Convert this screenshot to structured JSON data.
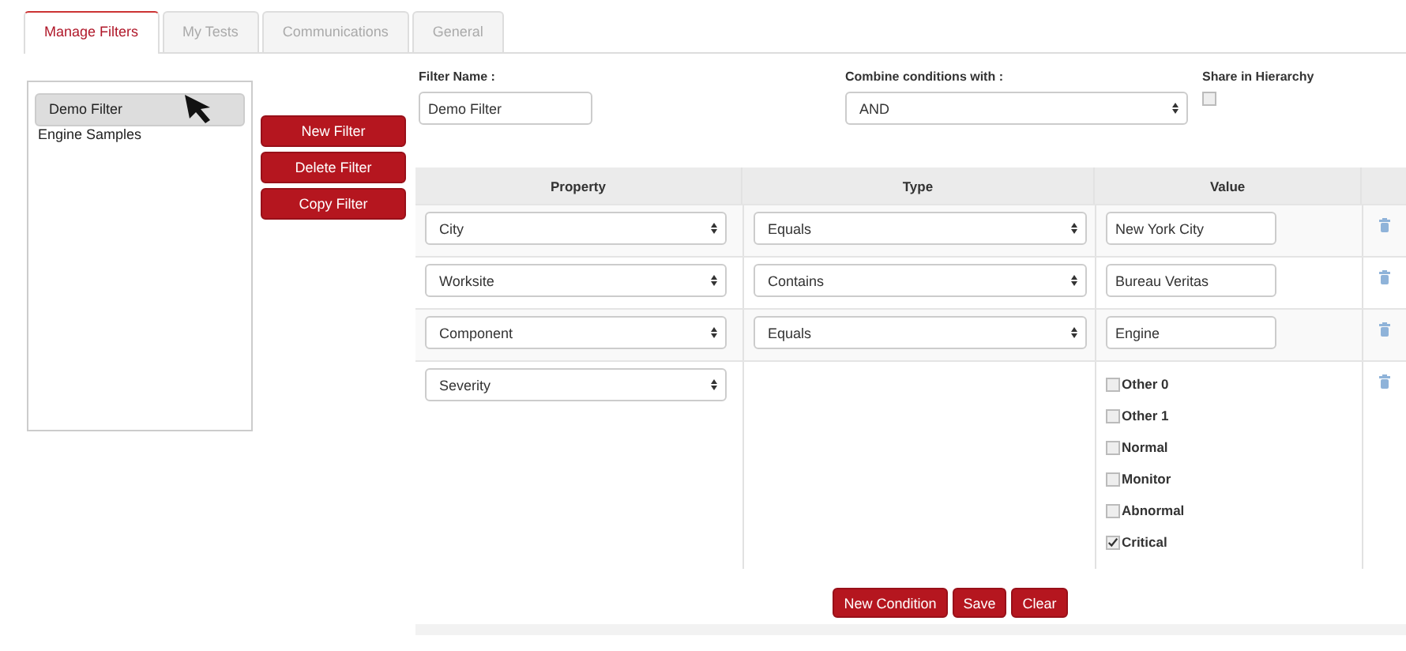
{
  "tabs": [
    {
      "label": "Manage Filters",
      "selected": true
    },
    {
      "label": "My Tests",
      "selected": false
    },
    {
      "label": "Communications",
      "selected": false
    },
    {
      "label": "General",
      "selected": false
    }
  ],
  "filter_list": [
    {
      "label": "Demo Filter",
      "selected": true
    },
    {
      "label": "Engine Samples",
      "selected": false
    }
  ],
  "filter_buttons": [
    "New Filter",
    "Delete Filter",
    "Copy Filter"
  ],
  "filter_name": {
    "label": "Filter Name :",
    "value": "Demo Filter"
  },
  "combine": {
    "label": "Combine conditions with :",
    "value": "AND"
  },
  "share": {
    "label": "Share in Hierarchy",
    "checked": false
  },
  "table": {
    "columns": [
      "Property",
      "Type",
      "Value"
    ],
    "rows": [
      {
        "kind": "text",
        "property": "City",
        "type": "Equals",
        "value": "New York City"
      },
      {
        "kind": "text",
        "property": "Worksite",
        "type": "Contains",
        "value": "Bureau Veritas"
      },
      {
        "kind": "text",
        "property": "Component",
        "type": "Equals",
        "value": "Engine"
      },
      {
        "kind": "checklist",
        "property": "Severity",
        "options": [
          {
            "label": "Other 0",
            "checked": false
          },
          {
            "label": "Other 1",
            "checked": false
          },
          {
            "label": "Normal",
            "checked": false
          },
          {
            "label": "Monitor",
            "checked": false
          },
          {
            "label": "Abnormal",
            "checked": false
          },
          {
            "label": "Critical",
            "checked": true
          }
        ]
      }
    ]
  },
  "actions": [
    "New Condition",
    "Save",
    "Clear"
  ]
}
